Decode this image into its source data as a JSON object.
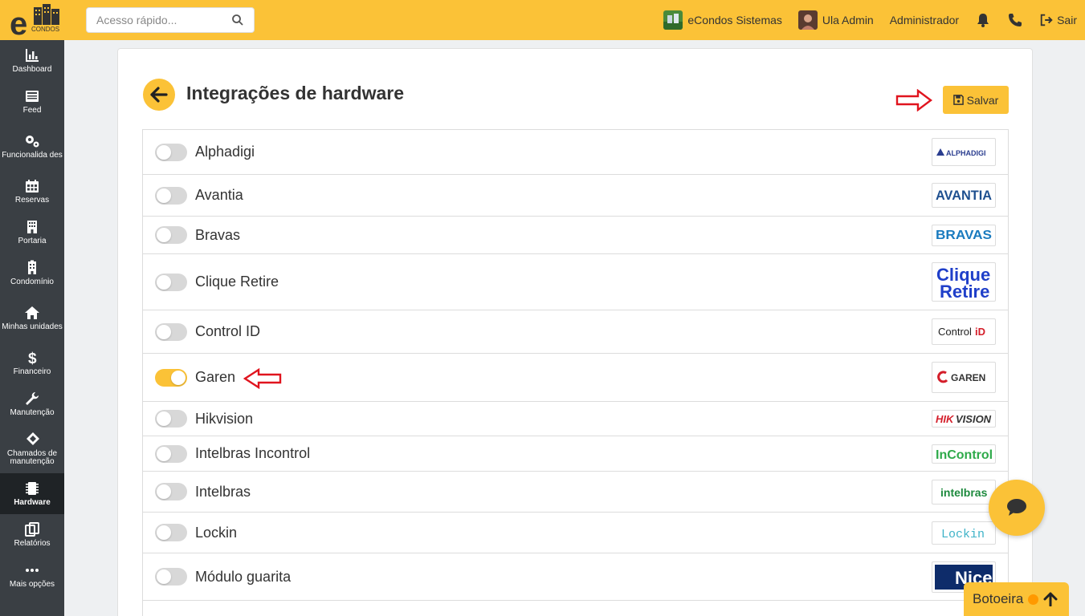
{
  "search": {
    "placeholder": "Acesso rápido..."
  },
  "topbar": {
    "condo_name": "eCondos Sistemas",
    "user_name": "Ula Admin",
    "role": "Administrador",
    "logout_label": "Sair"
  },
  "sidebar": {
    "items": [
      {
        "label": "Dashboard"
      },
      {
        "label": "Feed"
      },
      {
        "label": "Funcionalida des"
      },
      {
        "label": "Reservas"
      },
      {
        "label": "Portaria"
      },
      {
        "label": "Condomínio"
      },
      {
        "label": "Minhas unidades"
      },
      {
        "label": "Financeiro"
      },
      {
        "label": "Manutenção"
      },
      {
        "label": "Chamados de manutenção"
      },
      {
        "label": "Hardware"
      },
      {
        "label": "Relatórios"
      },
      {
        "label": "Mais opções"
      }
    ]
  },
  "page": {
    "title": "Integrações de hardware",
    "save_label": "Salvar"
  },
  "integrations": [
    {
      "name": "Alphadigi",
      "enabled": false,
      "logo_text": "ALPHADIGI"
    },
    {
      "name": "Avantia",
      "enabled": false,
      "logo_text": "AVANTIA"
    },
    {
      "name": "Bravas",
      "enabled": false,
      "logo_text": "BRAVAS"
    },
    {
      "name": "Clique Retire",
      "enabled": false,
      "logo_text": "Clique Retire"
    },
    {
      "name": "Control ID",
      "enabled": false,
      "logo_text": "Control iD"
    },
    {
      "name": "Garen",
      "enabled": true,
      "logo_text": "GAREN"
    },
    {
      "name": "Hikvision",
      "enabled": false,
      "logo_text": "HIKVISION"
    },
    {
      "name": "Intelbras Incontrol",
      "enabled": false,
      "logo_text": "InControl"
    },
    {
      "name": "Intelbras",
      "enabled": false,
      "logo_text": "intelbras"
    },
    {
      "name": "Lockin",
      "enabled": false,
      "logo_text": "Lockin"
    },
    {
      "name": "Módulo guarita",
      "enabled": false,
      "logo_text": "Nice"
    }
  ],
  "floating": {
    "botoeira_label": "Botoeira"
  },
  "colors": {
    "accent": "#fbc237",
    "sidebar": "#3a3f44",
    "active": "#1f2326",
    "annotation_arrow": "#e0141e"
  }
}
